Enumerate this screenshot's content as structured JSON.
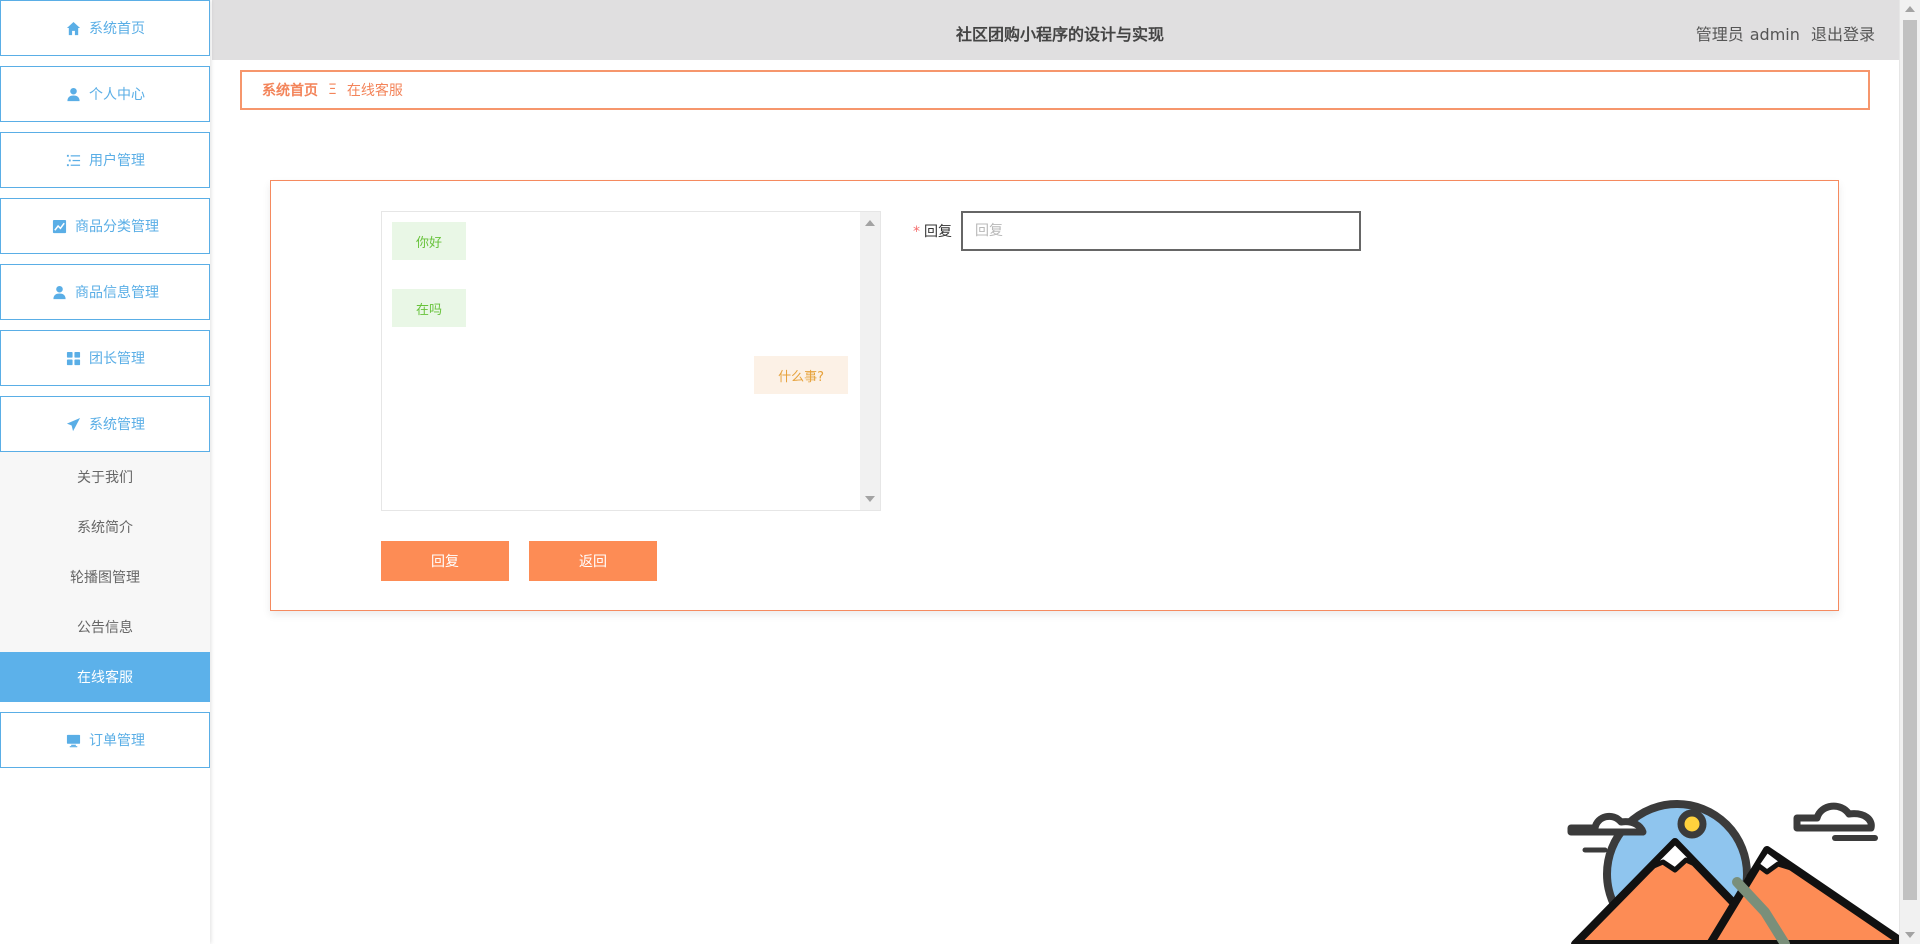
{
  "sidebar": {
    "items": [
      {
        "label": "系统首页",
        "icon": "home-icon"
      },
      {
        "label": "个人中心",
        "icon": "user-icon"
      },
      {
        "label": "用户管理",
        "icon": "list-icon"
      },
      {
        "label": "商品分类管理",
        "icon": "chart-icon"
      },
      {
        "label": "商品信息管理",
        "icon": "user-icon"
      },
      {
        "label": "团长管理",
        "icon": "grid-icon"
      },
      {
        "label": "系统管理",
        "icon": "send-icon"
      }
    ],
    "system_sub": [
      {
        "label": "关于我们"
      },
      {
        "label": "系统简介"
      },
      {
        "label": "轮播图管理"
      },
      {
        "label": "公告信息"
      },
      {
        "label": "在线客服",
        "active": true
      }
    ],
    "last_item": {
      "label": "订单管理",
      "icon": "monitor-icon"
    }
  },
  "header": {
    "title": "社区团购小程序的设计与实现",
    "role": "管理员",
    "user": "admin",
    "logout": "退出登录"
  },
  "breadcrumb": {
    "home": "系统首页",
    "separator": "Ξ",
    "current": "在线客服"
  },
  "chat": {
    "messages": [
      {
        "text": "你好",
        "side": "left"
      },
      {
        "text": "在吗",
        "side": "left"
      },
      {
        "text": "什么事?",
        "side": "right"
      }
    ]
  },
  "form": {
    "label": "回复",
    "required_mark": "*",
    "input_value": "",
    "input_placeholder": "回复"
  },
  "buttons": {
    "reply": "回复",
    "back": "返回"
  },
  "colors": {
    "accent_blue": "#5aaee6",
    "accent_orange": "#fd8c55",
    "header_bg": "#e0dfe0"
  }
}
